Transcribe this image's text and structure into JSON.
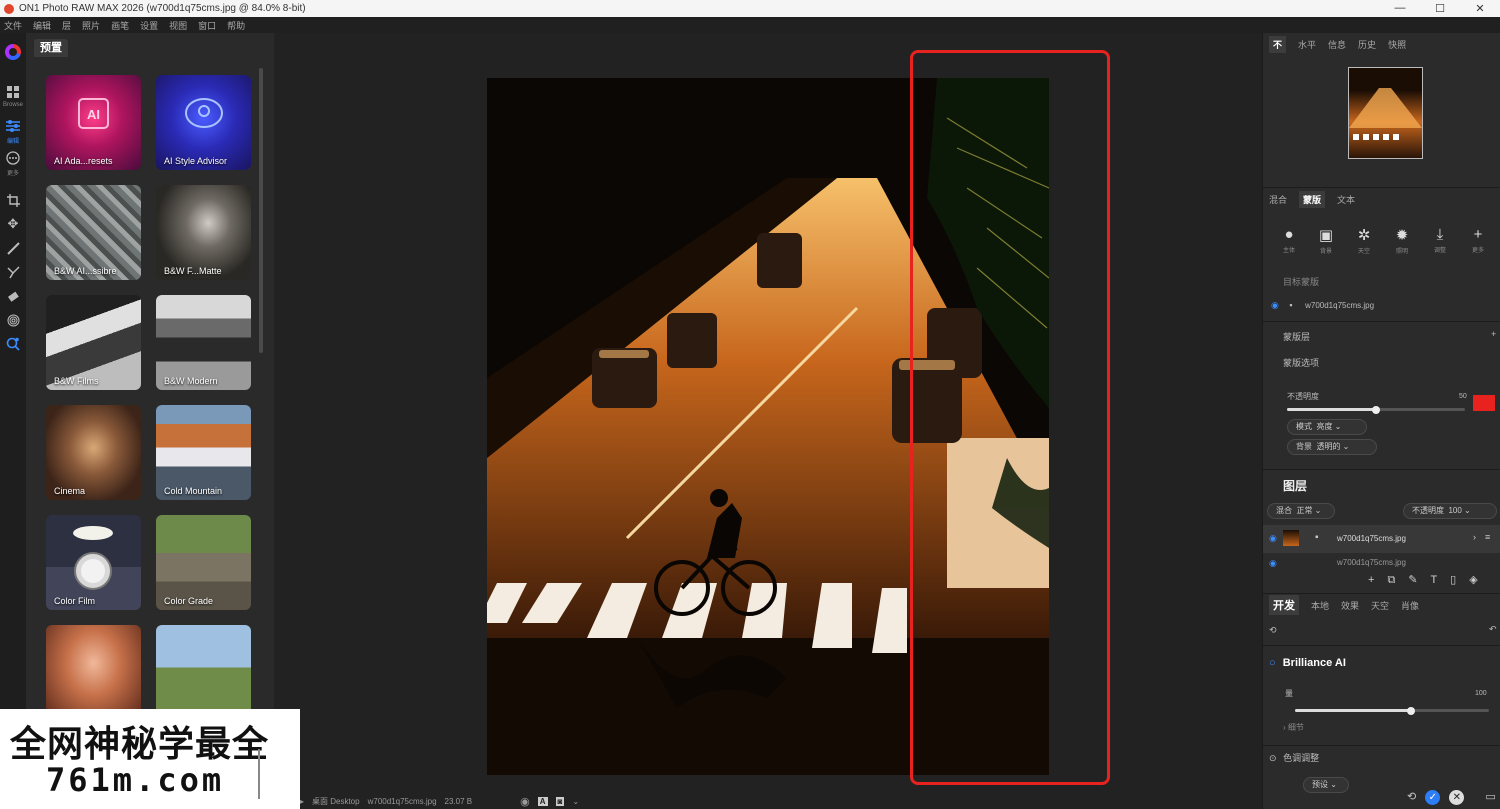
{
  "window": {
    "title": "ON1 Photo RAW MAX 2026 (w700d1q75cms.jpg @ 84.0% 8-bit)",
    "controls": [
      "—",
      "☐",
      "✕"
    ]
  },
  "menu": [
    "文件",
    "编辑",
    "层",
    "照片",
    "画笔",
    "设置",
    "视图",
    "窗口",
    "帮助"
  ],
  "tools": {
    "browse_label": "Browse",
    "edit_label": "编辑",
    "more_label": "更多"
  },
  "left_panel": {
    "tab": "预置",
    "presets": [
      {
        "label": "AI Ada...resets"
      },
      {
        "label": "AI Style Advisor"
      },
      {
        "label": "B&W AI...ssibre"
      },
      {
        "label": "B&W F...Matte"
      },
      {
        "label": "B&W Films"
      },
      {
        "label": "B&W Modern"
      },
      {
        "label": "Cinema"
      },
      {
        "label": "Cold Mountain"
      },
      {
        "label": "Color Film"
      },
      {
        "label": "Color Grade"
      },
      {
        "label": ""
      },
      {
        "label": ""
      }
    ]
  },
  "status_bar": {
    "path": "桌面 Desktop",
    "file": "w700d1q75cms.jpg",
    "size": "23.07 B"
  },
  "right_panel": {
    "nav_tabs": [
      "不",
      "水平",
      "信息",
      "历史",
      "快照"
    ],
    "mask_tabs": [
      "混合",
      "蒙版",
      "文本"
    ],
    "mask_tools": [
      {
        "icon": "person-icon",
        "cap": "主体"
      },
      {
        "icon": "portrait-icon",
        "cap": "背景"
      },
      {
        "icon": "settings-cloud-icon",
        "cap": "天空"
      },
      {
        "icon": "lightbulb-icon",
        "cap": "照明"
      },
      {
        "icon": "download-icon",
        "cap": "调整"
      },
      {
        "icon": "plus-icon",
        "cap": "更多"
      }
    ],
    "target_label": "目标蒙版",
    "target_file": "w700d1q75cms.jpg",
    "mask_layer_label": "蒙版层",
    "view_options_label": "蒙版选项",
    "opacity_label": "不透明度",
    "opacity_value": "50",
    "overlay_color": "#e8221f",
    "mode_label": "模式",
    "mode_value": "亮度",
    "bg_label": "背景",
    "bg_value": "透明的",
    "layers": {
      "title": "图层",
      "blend_label": "混合",
      "blend_value": "正常",
      "opacity_label": "不透明度",
      "opacity_value": "100",
      "items": [
        {
          "name": "w700d1q75cms.jpg"
        },
        {
          "name": "w700d1q75cms.jpg"
        }
      ]
    },
    "develop_tabs": [
      "开发",
      "本地",
      "效果",
      "天空",
      "肖像"
    ],
    "brilliance": {
      "title": "Brilliance AI",
      "amount_label": "量",
      "amount_value": "100",
      "amount_fraction": 0.6,
      "details_label": "细节"
    },
    "tone_label": "色调调整",
    "preset_pill": "预设"
  },
  "watermark": {
    "line1": "全网神秘学最全",
    "line2": "761m.com"
  }
}
